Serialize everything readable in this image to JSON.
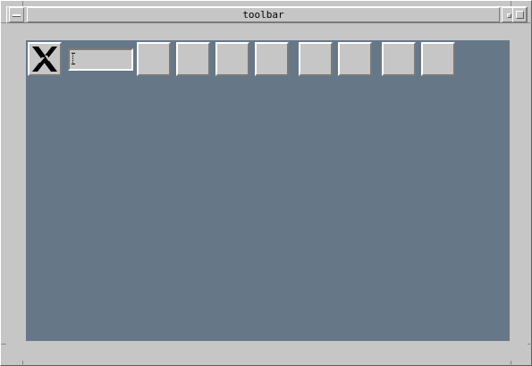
{
  "window": {
    "title": "toolbar"
  },
  "toolbar": {
    "logo_icon": "x-logo-icon",
    "text_field": {
      "value": "",
      "placeholder": ""
    },
    "buttons": [
      {
        "label": ""
      },
      {
        "label": ""
      },
      {
        "label": ""
      },
      {
        "label": ""
      },
      {
        "label": ""
      },
      {
        "label": ""
      },
      {
        "label": ""
      },
      {
        "label": ""
      }
    ]
  },
  "colors": {
    "background": "#c6c6c6",
    "client_area": "#667788",
    "highlight": "#ffffff",
    "shadow": "#7a7a7a"
  }
}
